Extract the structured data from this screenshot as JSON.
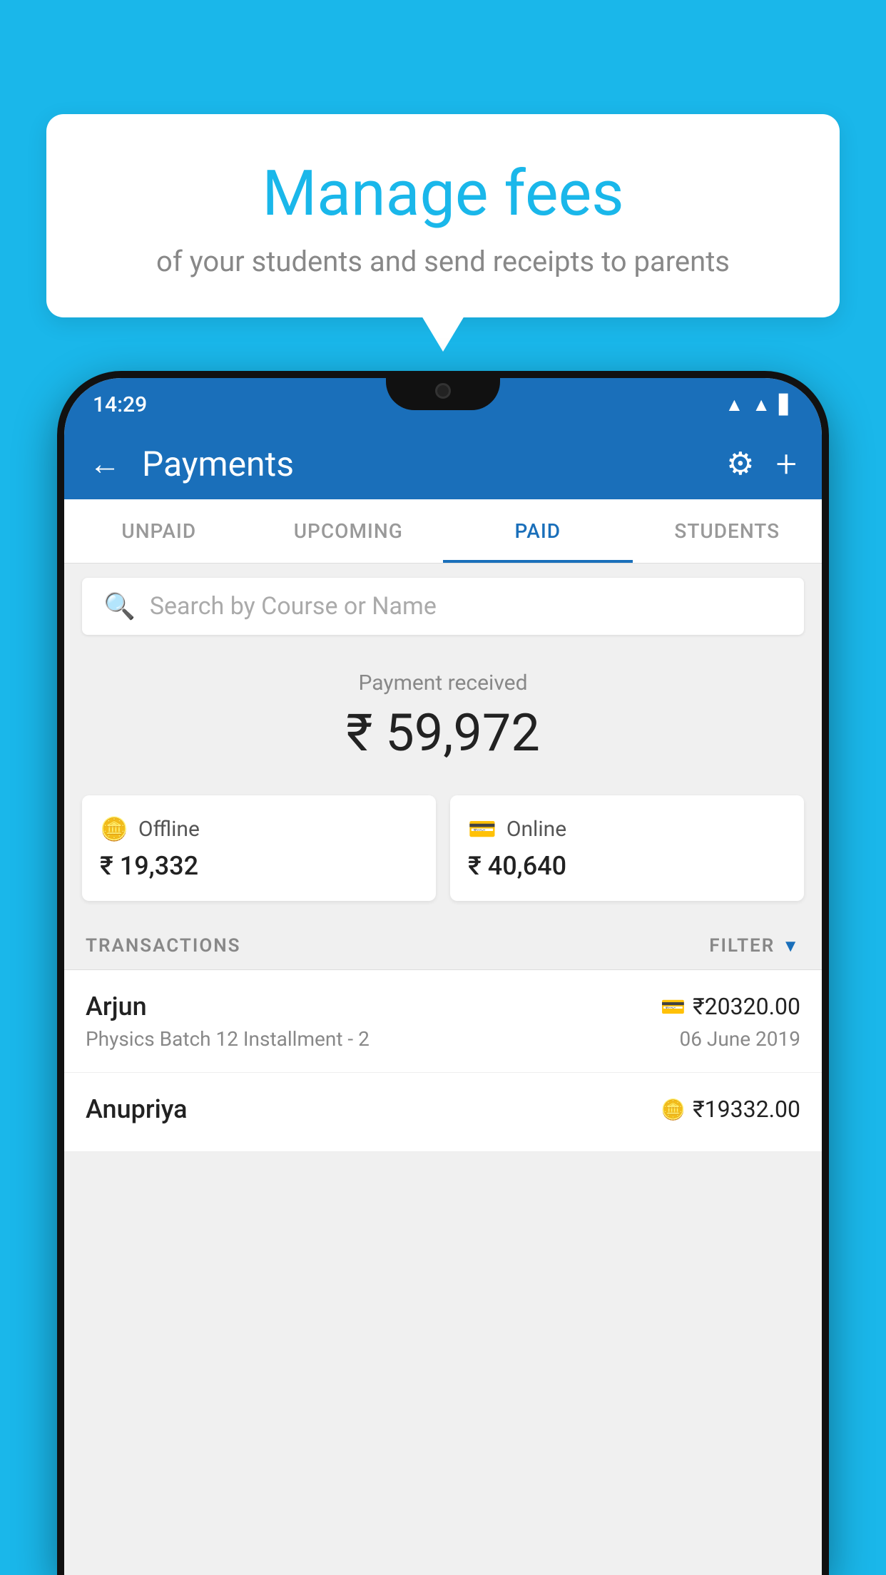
{
  "bubble": {
    "title": "Manage fees",
    "subtitle": "of your students and send receipts to parents"
  },
  "statusBar": {
    "time": "14:29"
  },
  "header": {
    "title": "Payments"
  },
  "tabs": [
    {
      "label": "UNPAID",
      "active": false
    },
    {
      "label": "UPCOMING",
      "active": false
    },
    {
      "label": "PAID",
      "active": true
    },
    {
      "label": "STUDENTS",
      "active": false
    }
  ],
  "search": {
    "placeholder": "Search by Course or Name"
  },
  "paymentReceived": {
    "label": "Payment received",
    "amount": "₹ 59,972"
  },
  "cards": {
    "offline": {
      "label": "Offline",
      "amount": "₹ 19,332"
    },
    "online": {
      "label": "Online",
      "amount": "₹ 40,640"
    }
  },
  "transactions": {
    "sectionLabel": "TRANSACTIONS",
    "filterLabel": "FILTER",
    "items": [
      {
        "name": "Arjun",
        "amount": "₹20320.00",
        "course": "Physics Batch 12 Installment - 2",
        "date": "06 June 2019",
        "paymentType": "online"
      },
      {
        "name": "Anupriya",
        "amount": "₹19332.00",
        "course": "",
        "date": "",
        "paymentType": "offline"
      }
    ]
  }
}
